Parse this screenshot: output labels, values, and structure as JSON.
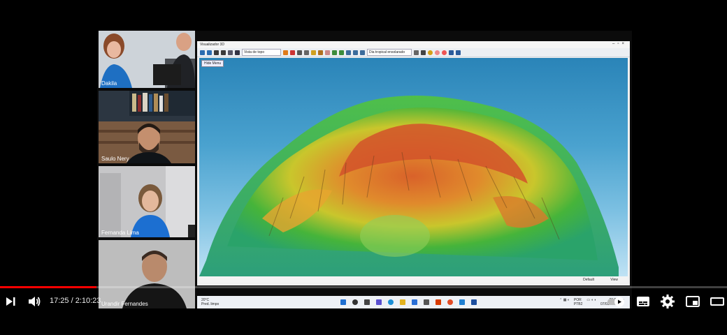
{
  "participants": [
    {
      "name": "Dakila"
    },
    {
      "name": "Saulo Nery"
    },
    {
      "name": "Fernanda Lima"
    },
    {
      "name": "Urandir Fernandes"
    }
  ],
  "viewer": {
    "title": "Visualizador 3D",
    "view_select": "Vista de topo",
    "palette_select": "Dia tropical ensolarado",
    "hide_button": "Hide Menu",
    "status_left": "Default",
    "status_right": "View"
  },
  "taskbar": {
    "temperature": "20°C",
    "weather": "Pred. limpo",
    "language_1": "POR",
    "language_2": "PTB2",
    "clock_time": "20:22",
    "clock_date": "07/03/2022"
  },
  "player": {
    "current_time": "17:25",
    "separator": " / ",
    "duration": "2:10:23",
    "progress": 0.133,
    "accent_color": "#ff0000"
  },
  "icons": [
    "next-icon",
    "volume-icon",
    "autoplay-toggle-icon",
    "subtitles-icon",
    "settings-gear-icon",
    "miniplayer-icon",
    "theater-icon"
  ]
}
